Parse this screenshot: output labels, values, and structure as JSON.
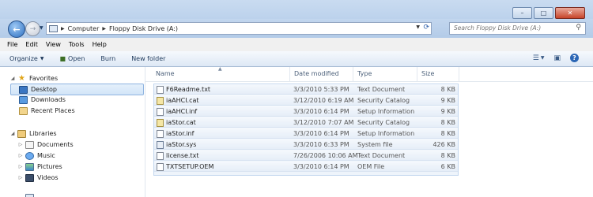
{
  "window": {
    "caption_buttons": [
      {
        "name": "minimize",
        "glyph": "–"
      },
      {
        "name": "maximize",
        "glyph": "□"
      },
      {
        "name": "close",
        "glyph": "✕"
      }
    ]
  },
  "address": {
    "segments": [
      "Computer",
      "Floppy Disk Drive (A:)"
    ]
  },
  "search": {
    "placeholder": "Search Floppy Disk Drive (A:)"
  },
  "menu": [
    "File",
    "Edit",
    "View",
    "Tools",
    "Help"
  ],
  "toolbar": {
    "organize": "Organize",
    "open": "Open",
    "burn": "Burn",
    "new_folder": "New folder"
  },
  "nav": {
    "favorites": "Favorites",
    "desktop": "Desktop",
    "downloads": "Downloads",
    "recent": "Recent Places",
    "libraries": "Libraries",
    "documents": "Documents",
    "music": "Music",
    "pictures": "Pictures",
    "videos": "Videos"
  },
  "columns": {
    "name": "Name",
    "date": "Date modified",
    "type": "Type",
    "size": "Size"
  },
  "files": [
    {
      "name": "F6Readme.txt",
      "date": "3/3/2010 5:33 PM",
      "type": "Text Document",
      "size": "8 KB",
      "icon": "txt"
    },
    {
      "name": "iaAHCI.cat",
      "date": "3/12/2010 6:19 AM",
      "type": "Security Catalog",
      "size": "9 KB",
      "icon": "cat"
    },
    {
      "name": "iaAHCI.inf",
      "date": "3/3/2010 6:14 PM",
      "type": "Setup Information",
      "size": "9 KB",
      "icon": "inf"
    },
    {
      "name": "iaStor.cat",
      "date": "3/12/2010 7:07 AM",
      "type": "Security Catalog",
      "size": "8 KB",
      "icon": "cat"
    },
    {
      "name": "iaStor.inf",
      "date": "3/3/2010 6:14 PM",
      "type": "Setup Information",
      "size": "8 KB",
      "icon": "inf"
    },
    {
      "name": "iaStor.sys",
      "date": "3/3/2010 6:33 PM",
      "type": "System file",
      "size": "426 KB",
      "icon": "sys"
    },
    {
      "name": "license.txt",
      "date": "7/26/2006 10:06 AM",
      "type": "Text Document",
      "size": "8 KB",
      "icon": "txt"
    },
    {
      "name": "TXTSETUP.OEM",
      "date": "3/3/2010 6:14 PM",
      "type": "OEM File",
      "size": "6 KB",
      "icon": "oem"
    }
  ]
}
